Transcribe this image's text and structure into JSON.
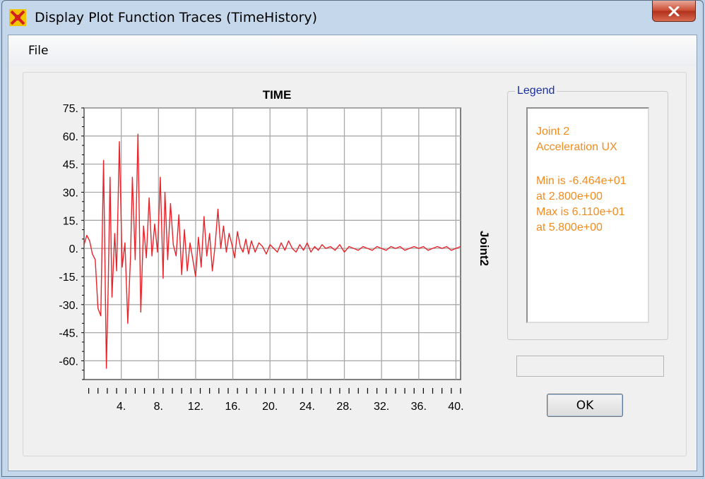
{
  "window": {
    "title": "Display Plot Function Traces  (TimeHistory)",
    "icon": "csi-app-icon",
    "close_icon": "close-icon"
  },
  "menu": {
    "items": [
      "File"
    ]
  },
  "legend": {
    "caption": "Legend",
    "lines": [
      "Joint 2",
      "Acceleration  UX",
      "",
      "Min is -6.464e+01",
      "at 2.800e+00",
      "Max is 6.110e+01",
      "at 5.800e+00"
    ],
    "text_color": "#f28c1e"
  },
  "buttons": {
    "ok": "OK"
  },
  "chart_data": {
    "type": "line",
    "title": "TIME",
    "ylabel": "Joint2",
    "xlabel": "",
    "xlim": [
      0,
      40.5
    ],
    "ylim": [
      -70,
      75
    ],
    "x_ticks": [
      "4.",
      "8.",
      "12.",
      "16.",
      "20.",
      "24.",
      "28.",
      "32.",
      "36.",
      "40."
    ],
    "y_ticks": [
      "75.",
      "60.",
      "45.",
      "30.",
      "15.",
      "0.",
      "-15.",
      "-30.",
      "-45.",
      "-60."
    ],
    "grid": true,
    "series": [
      {
        "color": "#e8232a",
        "x": [
          0.0,
          0.3,
          0.6,
          0.9,
          1.2,
          1.5,
          1.8,
          2.1,
          2.4,
          2.6,
          2.8,
          3.0,
          3.3,
          3.5,
          3.8,
          4.1,
          4.4,
          4.7,
          5.0,
          5.2,
          5.5,
          5.8,
          6.1,
          6.4,
          6.7,
          7.0,
          7.3,
          7.6,
          7.9,
          8.2,
          8.5,
          8.7,
          9.0,
          9.3,
          9.6,
          9.9,
          10.2,
          10.5,
          10.8,
          11.1,
          11.4,
          11.7,
          12.0,
          12.3,
          12.6,
          12.9,
          13.2,
          13.5,
          13.8,
          14.1,
          14.4,
          14.7,
          15.0,
          15.3,
          15.6,
          15.9,
          16.2,
          16.5,
          16.8,
          17.1,
          17.4,
          17.7,
          18.0,
          18.4,
          18.8,
          19.2,
          19.6,
          20.0,
          20.4,
          20.8,
          21.2,
          21.6,
          22.0,
          22.4,
          22.8,
          23.2,
          23.6,
          24.0,
          24.4,
          24.8,
          25.2,
          25.6,
          26.0,
          26.5,
          27.0,
          27.5,
          28.0,
          28.5,
          29.0,
          29.5,
          30.0,
          30.5,
          31.0,
          31.5,
          32.0,
          32.5,
          33.0,
          33.5,
          34.0,
          34.5,
          35.0,
          35.5,
          36.0,
          36.5,
          37.0,
          37.5,
          38.0,
          38.5,
          39.0,
          39.5,
          40.0,
          40.5
        ],
        "y": [
          2,
          7,
          4,
          -3,
          -6,
          -32,
          -36,
          47,
          -64,
          -20,
          38,
          -26,
          8,
          -12,
          57,
          -10,
          3,
          -40,
          -4,
          38,
          -6,
          61,
          -34,
          12,
          -5,
          27,
          -4,
          13,
          -2,
          38,
          -16,
          30,
          -6,
          24,
          2,
          -4,
          18,
          -14,
          10,
          -12,
          3,
          -6,
          -15,
          6,
          -10,
          17,
          -4,
          8,
          -12,
          2,
          21,
          0,
          12,
          -2,
          8,
          2,
          -5,
          9,
          1,
          -2,
          5,
          -3,
          4,
          -2,
          3,
          1,
          -3,
          2,
          0,
          -2,
          3,
          -1,
          4,
          0,
          -2,
          2,
          -1,
          3,
          -2,
          1,
          -1,
          2,
          0,
          1,
          -1,
          2,
          -2,
          1,
          0,
          -1,
          1,
          0,
          -1,
          1,
          0,
          -1,
          1,
          0,
          1,
          -1,
          0,
          1,
          0,
          1,
          -1,
          0,
          1,
          0,
          1,
          -1,
          0,
          1
        ]
      }
    ]
  }
}
